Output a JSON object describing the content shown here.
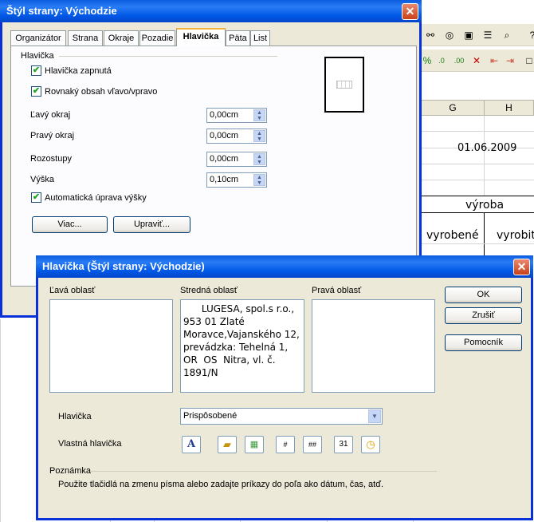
{
  "background_sheet": {
    "column_headers": [
      "G",
      "H"
    ],
    "date_cell": "01.06.2009",
    "merged_cell": "výroba",
    "cells": [
      "vyrobené",
      "vyrobit"
    ]
  },
  "page_style_dialog": {
    "title": "Štýl strany: Východzie",
    "tabs": [
      "Organizátor",
      "Strana",
      "Okraje",
      "Pozadie",
      "Hlavička",
      "Päta",
      "List"
    ],
    "active_tab": "Hlavička",
    "section_title": "Hlavička",
    "header_on_label": "Hlavička zapnutá",
    "header_on_checked": true,
    "same_content_label": "Rovnaký obsah vľavo/vpravo",
    "same_content_checked": true,
    "left_margin_label": "Ľavý okraj",
    "left_margin_value": "0,00cm",
    "right_margin_label": "Pravý okraj",
    "right_margin_value": "0,00cm",
    "spacing_label": "Rozostupy",
    "spacing_value": "0,00cm",
    "height_label": "Výška",
    "height_value": "0,10cm",
    "autofit_label": "Automatická úprava výšky",
    "autofit_checked": true,
    "more_button": "Viac...",
    "edit_button": "Upraviť..."
  },
  "header_dialog": {
    "title": "Hlavička (Štýl strany: Východzie)",
    "left_area_label": "Ľavá oblasť",
    "center_area_label": "Stredná oblasť",
    "right_area_label": "Pravá oblasť",
    "center_area_lines": [
      "      LUGESA, spol.s r.o.,",
      "953 01 Zlaté",
      "Moravce,Vajanského 12,",
      "prevádzka: Tehelná 1,",
      "OR  OS  Nitra, vl. č.",
      "1891/N"
    ],
    "ok_button": "OK",
    "cancel_button": "Zrušiť",
    "help_button": "Pomocník",
    "header_label": "Hlavička",
    "header_select_value": "Prispôsobené",
    "custom_header_label": "Vlastná hlavička",
    "toolbar_icons": [
      "text-attributes-icon",
      "file-name-icon",
      "sheet-name-icon",
      "page-icon",
      "pages-icon",
      "date-icon",
      "time-icon"
    ],
    "note_title": "Poznámka",
    "note_text": "Použite tlačidlá na zmenu písma alebo zadajte príkazy do poľa ako dátum, čas, atď."
  },
  "colors": {
    "titlebar": "#0058e6",
    "dialog_bg": "#ece9d8",
    "close_button": "#c8411b",
    "check_mark": "#21a121"
  }
}
